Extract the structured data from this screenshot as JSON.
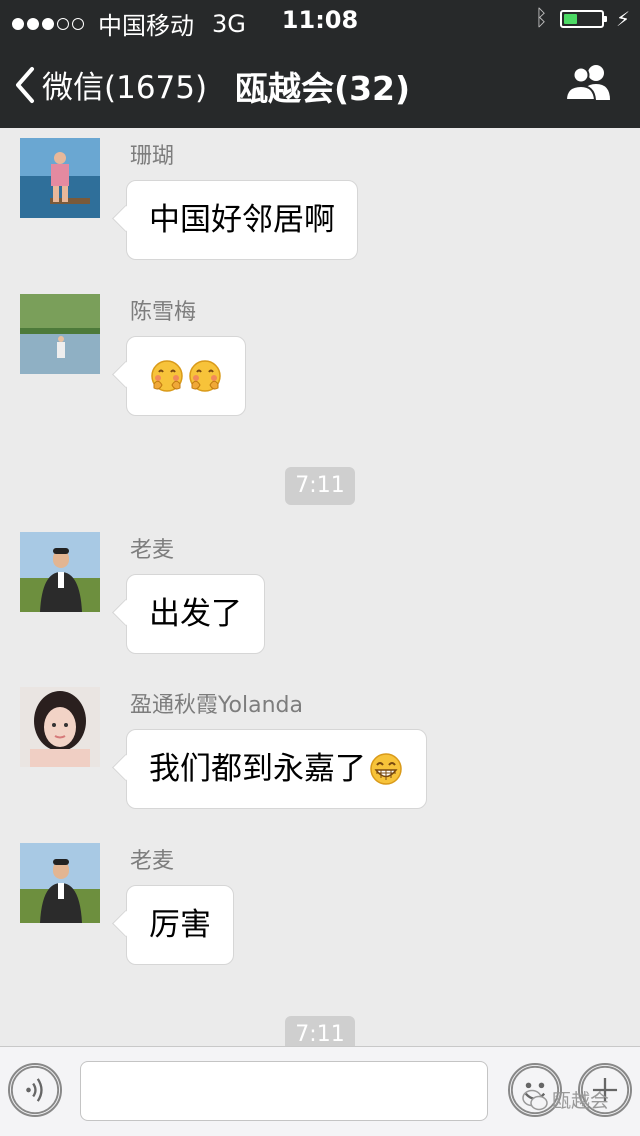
{
  "status_bar": {
    "carrier": "中国移动",
    "network": "3G",
    "time": "11:08",
    "battery_level": 0.35
  },
  "nav": {
    "back_label": "微信(1675)",
    "title": "瓯越会(32)"
  },
  "messages": [
    {
      "sender": "珊瑚",
      "text": "中国好邻居啊",
      "emoji_count": 0
    },
    {
      "sender": "陈雪梅",
      "text": "",
      "emoji": "hug-emoji",
      "emoji_count": 2
    },
    {
      "sender": "老麦",
      "text": "出发了",
      "emoji_count": 0
    },
    {
      "sender": "盈通秋霞Yolanda",
      "text": "我们都到永嘉了",
      "emoji": "grin-emoji",
      "emoji_count": 1
    },
    {
      "sender": "老麦",
      "text": "厉害",
      "emoji_count": 0
    }
  ],
  "timestamps": [
    "7:11",
    "7:11"
  ],
  "watermark": "瓯越会",
  "colors": {
    "bar": "#27292a",
    "chat_bg": "#ebebeb",
    "battery": "#4cd964"
  }
}
